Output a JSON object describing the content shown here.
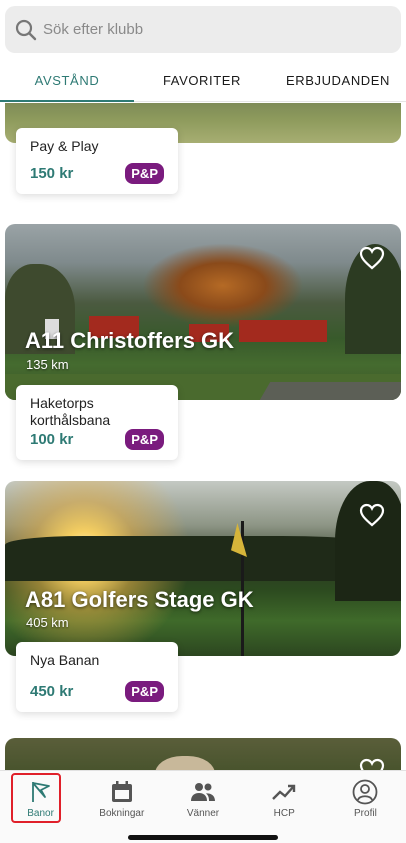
{
  "search": {
    "placeholder": "Sök efter klubb"
  },
  "tabs": [
    {
      "label": "AVSTÅND",
      "active": true
    },
    {
      "label": "FAVORITER",
      "active": false
    },
    {
      "label": "ERBJUDANDEN",
      "active": false
    }
  ],
  "clubs": [
    {
      "offer": {
        "title": "Pay & Play",
        "price": "150 kr",
        "badge": "P&P"
      }
    },
    {
      "name": "A11 Christoffers GK",
      "distance": "135 km",
      "favorite": false,
      "offer": {
        "title": "Haketorps korthålsbana",
        "price": "100 kr",
        "badge": "P&P"
      }
    },
    {
      "name": "A81 Golfers Stage GK",
      "distance": "405 km",
      "favorite": false,
      "offer": {
        "title": "Nya Banan",
        "price": "450 kr",
        "badge": "P&P"
      }
    },
    {
      "favorite": false
    }
  ],
  "nav": [
    {
      "label": "Banor",
      "icon": "flag-icon",
      "active": true
    },
    {
      "label": "Bokningar",
      "icon": "calendar-icon",
      "active": false
    },
    {
      "label": "Vänner",
      "icon": "people-icon",
      "active": false
    },
    {
      "label": "HCP",
      "icon": "trend-icon",
      "active": false
    },
    {
      "label": "Profil",
      "icon": "profile-icon",
      "active": false
    }
  ],
  "colors": {
    "accent": "#2e7a74",
    "badge": "#7a1b7e",
    "highlight": "#e0202a"
  }
}
